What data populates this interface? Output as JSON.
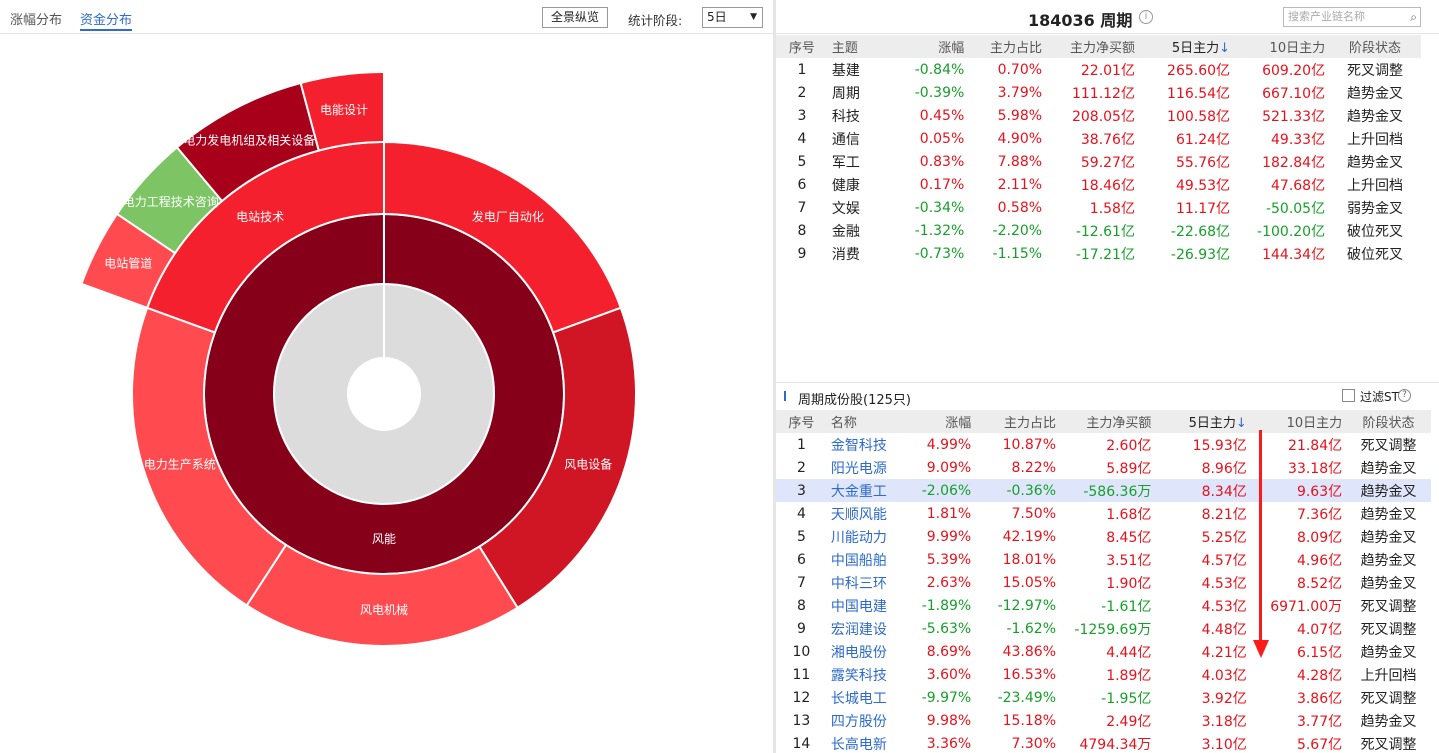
{
  "left": {
    "tabs": [
      "涨幅分布",
      "资金分布"
    ],
    "overview_btn": "全景纵览",
    "stat_label": "统计阶段:",
    "stat_value": "5日",
    "sunburst": {
      "center_label": "风能",
      "ring_labels": [
        "发电厂自动化",
        "风电设备",
        "风电机械",
        "电力生产系统",
        "电站技术"
      ],
      "outer_labels": [
        "电站管道",
        "电力工程技术咨询",
        "电力发电机组及相关设备",
        "电能设计"
      ],
      "colors": {
        "inner": "#86001a",
        "hub": "#dcdcdc",
        "ring_a": "#f4202e",
        "ring_b": "#d01525",
        "ring_c": "#ff4b4f",
        "green": "#7dc465",
        "dark": "#a8001a"
      }
    }
  },
  "right": {
    "title": "184036 周期",
    "search_placeholder": "搜索产业链名称",
    "table1": {
      "headers": [
        "序号",
        "主题",
        "涨幅",
        "主力占比",
        "主力净买额",
        "5日主力",
        "10日主力",
        "阶段状态"
      ],
      "rows": [
        [
          "1",
          "基建",
          "-0.84%",
          "0.70%",
          "22.01亿",
          "265.60亿",
          "609.20亿",
          "死叉调整"
        ],
        [
          "2",
          "周期",
          "-0.39%",
          "3.79%",
          "111.12亿",
          "116.54亿",
          "667.10亿",
          "趋势金叉"
        ],
        [
          "3",
          "科技",
          "0.45%",
          "5.98%",
          "208.05亿",
          "100.58亿",
          "521.33亿",
          "趋势金叉"
        ],
        [
          "4",
          "通信",
          "0.05%",
          "4.90%",
          "38.76亿",
          "61.24亿",
          "49.33亿",
          "上升回档"
        ],
        [
          "5",
          "军工",
          "0.83%",
          "7.88%",
          "59.27亿",
          "55.76亿",
          "182.84亿",
          "趋势金叉"
        ],
        [
          "6",
          "健康",
          "0.17%",
          "2.11%",
          "18.46亿",
          "49.53亿",
          "47.68亿",
          "上升回档"
        ],
        [
          "7",
          "文娱",
          "-0.34%",
          "0.58%",
          "1.58亿",
          "11.17亿",
          "-50.05亿",
          "弱势金叉"
        ],
        [
          "8",
          "金融",
          "-1.32%",
          "-2.20%",
          "-12.61亿",
          "-22.68亿",
          "-100.20亿",
          "破位死叉"
        ],
        [
          "9",
          "消费",
          "-0.73%",
          "-1.15%",
          "-17.21亿",
          "-26.93亿",
          "144.34亿",
          "破位死叉"
        ]
      ]
    },
    "sub_title": "周期成份股(125只)",
    "filter_label": "过滤ST",
    "table2": {
      "headers": [
        "序号",
        "名称",
        "涨幅",
        "主力占比",
        "主力净买额",
        "5日主力",
        "10日主力",
        "阶段状态"
      ],
      "rows": [
        [
          "1",
          "金智科技",
          "4.99%",
          "10.87%",
          "2.60亿",
          "15.93亿",
          "21.84亿",
          "死叉调整"
        ],
        [
          "2",
          "阳光电源",
          "9.09%",
          "8.22%",
          "5.89亿",
          "8.96亿",
          "33.18亿",
          "趋势金叉"
        ],
        [
          "3",
          "大金重工",
          "-2.06%",
          "-0.36%",
          "-586.36万",
          "8.34亿",
          "9.63亿",
          "趋势金叉"
        ],
        [
          "4",
          "天顺风能",
          "1.81%",
          "7.50%",
          "1.68亿",
          "8.21亿",
          "7.36亿",
          "趋势金叉"
        ],
        [
          "5",
          "川能动力",
          "9.99%",
          "42.19%",
          "8.45亿",
          "5.25亿",
          "8.09亿",
          "趋势金叉"
        ],
        [
          "6",
          "中国船舶",
          "5.39%",
          "18.01%",
          "3.51亿",
          "4.57亿",
          "4.96亿",
          "趋势金叉"
        ],
        [
          "7",
          "中科三环",
          "2.63%",
          "15.05%",
          "1.90亿",
          "4.53亿",
          "8.52亿",
          "趋势金叉"
        ],
        [
          "8",
          "中国电建",
          "-1.89%",
          "-12.97%",
          "-1.61亿",
          "4.53亿",
          "6971.00万",
          "死叉调整"
        ],
        [
          "9",
          "宏润建设",
          "-5.63%",
          "-1.62%",
          "-1259.69万",
          "4.48亿",
          "4.07亿",
          "死叉调整"
        ],
        [
          "10",
          "湘电股份",
          "8.69%",
          "43.86%",
          "4.44亿",
          "4.21亿",
          "6.15亿",
          "趋势金叉"
        ],
        [
          "11",
          "露笑科技",
          "3.60%",
          "16.53%",
          "1.89亿",
          "4.03亿",
          "4.28亿",
          "上升回档"
        ],
        [
          "12",
          "长城电工",
          "-9.97%",
          "-23.49%",
          "-1.95亿",
          "3.92亿",
          "3.86亿",
          "死叉调整"
        ],
        [
          "13",
          "四方股份",
          "9.98%",
          "15.18%",
          "2.49亿",
          "3.18亿",
          "3.77亿",
          "趋势金叉"
        ],
        [
          "14",
          "长高电新",
          "3.36%",
          "7.30%",
          "4794.34万",
          "3.10亿",
          "5.67亿",
          "死叉调整"
        ]
      ]
    }
  }
}
